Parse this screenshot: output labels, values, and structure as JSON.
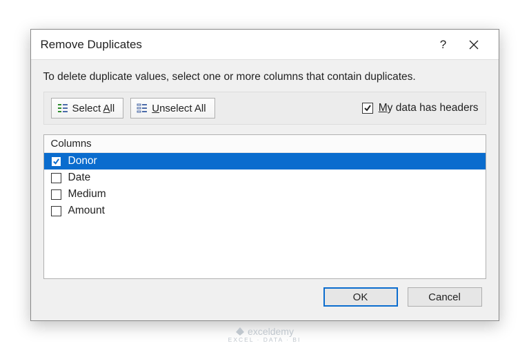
{
  "dialog": {
    "title": "Remove Duplicates",
    "instruction": "To delete duplicate values, select one or more columns that contain duplicates.",
    "select_all_label": "Select All",
    "select_all_accel": "A",
    "unselect_all_label": "Unselect All",
    "unselect_all_accel": "U",
    "headers_checkbox_label": "My data has headers",
    "headers_checkbox_accel": "M",
    "headers_checked": true,
    "columns_header": "Columns",
    "columns": [
      {
        "name": "Donor",
        "checked": true,
        "selected": true
      },
      {
        "name": "Date",
        "checked": false,
        "selected": false
      },
      {
        "name": "Medium",
        "checked": false,
        "selected": false
      },
      {
        "name": "Amount",
        "checked": false,
        "selected": false
      }
    ],
    "ok_label": "OK",
    "cancel_label": "Cancel"
  },
  "watermark": {
    "brand": "exceldemy",
    "tagline": "EXCEL · DATA · BI"
  }
}
